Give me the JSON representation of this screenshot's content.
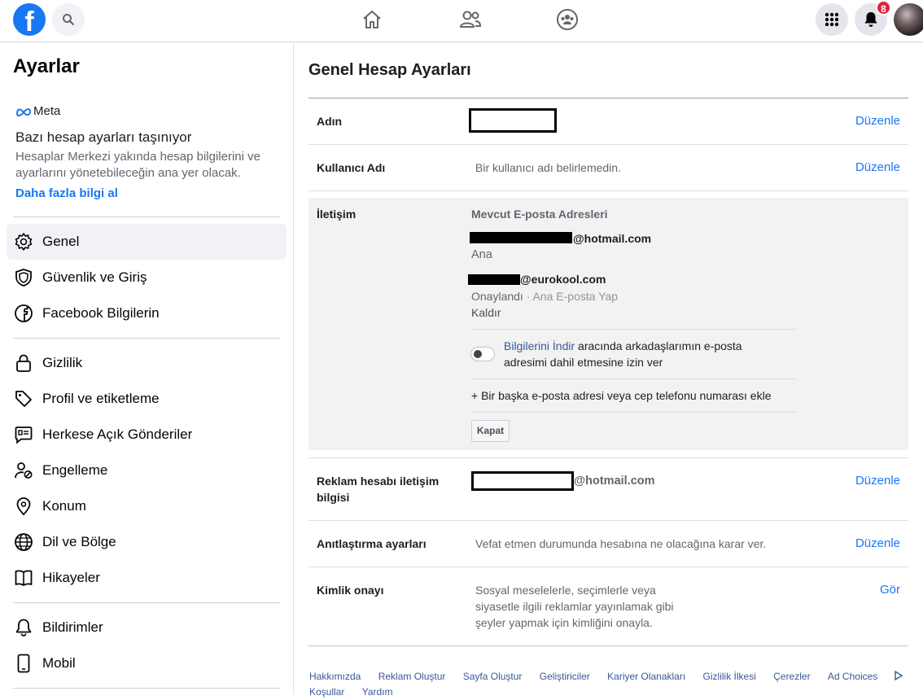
{
  "topbar": {
    "logo": "f",
    "notifications_badge": "8",
    "icons": [
      "facebook-logo-icon",
      "search-icon",
      "home-icon",
      "friends-icon",
      "groups-icon",
      "menu-grid-icon",
      "bell-icon",
      "avatar"
    ]
  },
  "sidebar": {
    "title": "Ayarlar",
    "meta_brand": "Meta",
    "meta_title": "Bazı hesap ayarları taşınıyor",
    "meta_desc": "Hesaplar Merkezi yakında hesap bilgilerini ve ayarlarını yönetebileceğin ana yer olacak.",
    "meta_link": "Daha fazla bilgi al",
    "items": [
      {
        "label": "Genel",
        "icon": "gear-icon"
      },
      {
        "label": "Güvenlik ve Giriş",
        "icon": "shield-icon"
      },
      {
        "label": "Facebook Bilgilerin",
        "icon": "facebook-icon"
      },
      {
        "label": "Gizlilik",
        "icon": "lock-icon"
      },
      {
        "label": "Profil ve etiketleme",
        "icon": "tag-icon"
      },
      {
        "label": "Herkese Açık Gönderiler",
        "icon": "post-icon"
      },
      {
        "label": "Engelleme",
        "icon": "block-user-icon"
      },
      {
        "label": "Konum",
        "icon": "location-pin-icon"
      },
      {
        "label": "Dil ve Bölge",
        "icon": "globe-icon"
      },
      {
        "label": "Hikayeler",
        "icon": "book-icon"
      },
      {
        "label": "Bildirimler",
        "icon": "bell-icon"
      },
      {
        "label": "Mobil",
        "icon": "mobile-icon"
      }
    ]
  },
  "main": {
    "title": "Genel Hesap Ayarları",
    "edit_label": "Düzenle",
    "view_label": "Gör",
    "rows": {
      "name": {
        "label": "Adın"
      },
      "username": {
        "label": "Kullanıcı Adı",
        "value": "Bir kullanıcı adı belirlemedin."
      },
      "contact": {
        "label": "İletişim",
        "heading": "Mevcut E-posta Adresleri",
        "email1_domain": "@hotmail.com",
        "email1_status": "Ana",
        "email2_domain": "@eurokool.com",
        "email2_status": "Onaylandı",
        "email2_make_primary": "Ana E-posta Yap",
        "email2_remove": "Kaldır",
        "download_link": "Bilgilerini İndir",
        "download_text": "aracında arkadaşlarımın e-posta adresimi dahil etmesine izin ver",
        "add_more": "+ Bir başka e-posta adresi veya cep telefonu numarası ekle",
        "close": "Kapat"
      },
      "ad_contact": {
        "label": "Reklam hesabı iletişim bilgisi",
        "value_domain": "@hotmail.com"
      },
      "memorial": {
        "label": "Anıtlaştırma ayarları",
        "value": "Vefat etmen durumunda hesabına ne olacağına karar ver."
      },
      "identity": {
        "label": "Kimlik onayı",
        "value": "Sosyal meselelerle, seçimlerle veya siyasetle ilgili reklamlar yayınlamak gibi şeyler yapmak için kimliğini onayla."
      }
    }
  },
  "footer": {
    "links": [
      "Hakkımızda",
      "Reklam Oluştur",
      "Sayfa Oluştur",
      "Geliştiriciler",
      "Kariyer Olanakları",
      "Gizlilik İlkesi",
      "Çerezler",
      "Ad Choices",
      "Koşullar",
      "Yardım"
    ]
  }
}
